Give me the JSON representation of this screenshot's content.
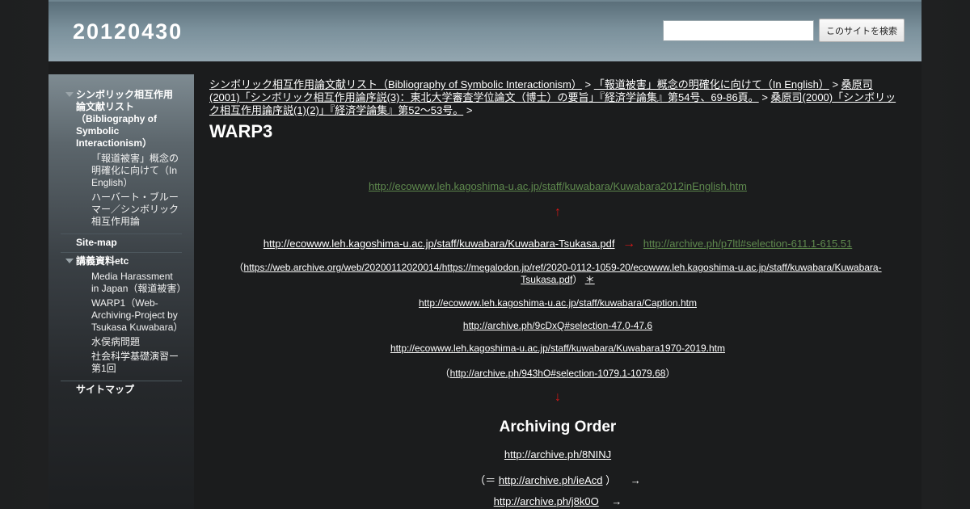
{
  "site": {
    "title": "20120430"
  },
  "search": {
    "placeholder": "",
    "button_label": "このサイトを検索"
  },
  "sidebar": {
    "items": [
      {
        "label": "シンボリック相互作用論文献リスト（Bibliography of Symbolic Interactionism）",
        "children": [
          "「報道被害」概念の明確化に向けて（In English）",
          "ハーバート・ブルーマー／シンボリック相互作用論"
        ]
      },
      {
        "label": "Site-map",
        "children": []
      },
      {
        "label": "講義資料etc",
        "children": [
          "Media Harassment in Japan（報道被害）",
          "WARP1（Web-Archiving-Project by Tsukasa Kuwabara）",
          "水俣病問題",
          "社会科学基礎演習ー第1回"
        ]
      },
      {
        "label": "サイトマップ",
        "children": []
      }
    ]
  },
  "breadcrumb": {
    "items": [
      "シンボリック相互作用論文献リスト（Bibliography of Symbolic Interactionism）",
      "「報道被害」概念の明確化に向けて（In English）",
      "桑原司(2001)「シンボリック相互作用論序説(3)：東北大学審査学位論文（博士）の要旨」『経済学論集』第54号、69-86頁。",
      "桑原司(2000)「シンボリック相互作用論序説(1)(2)」『経済学論集』第52～53号。"
    ],
    "separator": ">"
  },
  "page": {
    "title": "WARP3"
  },
  "content": {
    "link_english": "http://ecowww.leh.kagoshima-u.ac.jp/staff/kuwabara/Kuwabara2012inEnglish.htm",
    "arrow_up": "↑",
    "link_tsukasa_pdf": "http://ecowww.leh.kagoshima-u.ac.jp/staff/kuwabara/Kuwabara-Tsukasa.pdf",
    "arrow_right": "→",
    "link_archive_p7": "http://archive.ph/p7ltl#selection-611.1-615.51",
    "paren_open": "（",
    "link_webarchive": "https://web.archive.org/web/20200112020014/https://megalodon.jp/ref/2020-0112-1059-20/ecowww.leh.kagoshima-u.ac.jp/staff/kuwabara/Kuwabara-Tsukasa.pdf",
    "paren_close": "）",
    "link_star": "＊",
    "link_caption": "http://ecowww.leh.kagoshima-u.ac.jp/staff/kuwabara/Caption.htm",
    "link_archive_9c": "http://archive.ph/9cDxQ#selection-47.0-47.6",
    "link_1970": "http://ecowww.leh.kagoshima-u.ac.jp/staff/kuwabara/Kuwabara1970-2019.htm",
    "link_archive_943": "http://archive.ph/943hO#selection-1079.1-1079.68",
    "arrow_down": "↓",
    "archiving_order_heading": "Archiving Order",
    "link_8ninj": "http://archive.ph/8NINJ",
    "eq_open": "（＝",
    "link_ieacd": "http://archive.ph/ieAcd",
    "eq_close": "）",
    "arrow_plain": "→",
    "link_j8k0o": "http://archive.ph/j8k0O"
  },
  "colors": {
    "header": "#7a909b",
    "link_green": "#5f8a4e",
    "arrow_red": "#d81818",
    "background": "#1b1c1d"
  }
}
